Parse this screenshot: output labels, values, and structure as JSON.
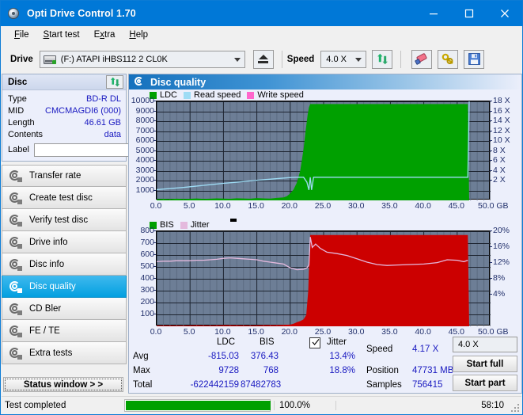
{
  "window": {
    "title": "Opti Drive Control 1.70",
    "icon": "disc-icon",
    "minimize": "minimize-icon",
    "maximize": "maximize-icon",
    "close": "close-icon"
  },
  "menubar": {
    "items": [
      {
        "label": "File",
        "accel": "F"
      },
      {
        "label": "Start test",
        "accel": "S"
      },
      {
        "label": "Extra",
        "accel": "x"
      },
      {
        "label": "Help",
        "accel": "H"
      }
    ]
  },
  "toolbar": {
    "drive_label": "Drive",
    "drive_value": "(F:)   ATAPI iHBS112   2 CL0K",
    "eject_icon": "eject-icon",
    "speed_label": "Speed",
    "speed_value": "4.0 X",
    "refresh_icon": "refresh-icon",
    "erase_icon": "eraser-icon",
    "tools_icon": "tools-icon",
    "save_icon": "save-icon"
  },
  "disc_panel": {
    "title": "Disc",
    "refresh_icon": "refresh-icon",
    "rows": [
      {
        "key": "Type",
        "value": "BD-R DL"
      },
      {
        "key": "MID",
        "value": "CMCMAGDI6 (000)"
      },
      {
        "key": "Length",
        "value": "46.61 GB"
      },
      {
        "key": "Contents",
        "value": "data"
      }
    ],
    "label_key": "Label",
    "label_value": "",
    "label_placeholder": "",
    "label_disc_icon": "cd-disc-icon"
  },
  "nav": {
    "items": [
      {
        "label": "Transfer rate",
        "selected": false
      },
      {
        "label": "Create test disc",
        "selected": false
      },
      {
        "label": "Verify test disc",
        "selected": false
      },
      {
        "label": "Drive info",
        "selected": false
      },
      {
        "label": "Disc info",
        "selected": false
      },
      {
        "label": "Disc quality",
        "selected": true
      },
      {
        "label": "CD Bler",
        "selected": false
      },
      {
        "label": "FE / TE",
        "selected": false
      },
      {
        "label": "Extra tests",
        "selected": false
      }
    ],
    "status_window_label": "Status window > >"
  },
  "main": {
    "header_title": "Disc quality",
    "header_icon": "disc-quality-icon"
  },
  "chart_data": [
    {
      "type": "area",
      "name": "ldc-chart",
      "title": "",
      "xlabel": "GB",
      "ylabel": "LDC",
      "legend": [
        {
          "label": "LDC",
          "color": "#00a000"
        },
        {
          "label": "Read speed",
          "color": "#9edcf5"
        },
        {
          "label": "Write speed",
          "color": "#ff66cc"
        }
      ],
      "legend_position": "top-left",
      "grid": true,
      "plot_bg": "#6d7e96",
      "xlim": [
        0,
        50
      ],
      "xticks": [
        "0.0",
        "5.0",
        "10.0",
        "15.0",
        "20.0",
        "25.0",
        "30.0",
        "35.0",
        "40.0",
        "45.0",
        "50.0"
      ],
      "xunit": "GB",
      "ylim": [
        0,
        10000
      ],
      "yticks": [
        "10000",
        "9000",
        "8000",
        "7000",
        "6000",
        "5000",
        "4000",
        "3000",
        "2000",
        "1000"
      ],
      "y2lim": [
        0,
        18
      ],
      "y2ticks": [
        "18 X",
        "16 X",
        "14 X",
        "12 X",
        "10 X",
        "8 X",
        "6 X",
        "4 X",
        "2 X"
      ],
      "series": [
        {
          "name": "LDC",
          "color": "#00a000",
          "kind": "area",
          "x": [
            0.0,
            1.0,
            2.0,
            3.0,
            4.0,
            5.0,
            6.0,
            7.0,
            8.0,
            9.0,
            10.0,
            11.0,
            12.0,
            13.0,
            14.0,
            15.0,
            16.0,
            17.0,
            18.0,
            19.0,
            19.5,
            20.0,
            20.5,
            21.0,
            21.5,
            22.0,
            22.3,
            22.6,
            22.8,
            23.0,
            24.0,
            28.0,
            32.0,
            36.0,
            40.0,
            44.0,
            46.6,
            46.8
          ],
          "values": [
            120,
            150,
            130,
            170,
            140,
            160,
            190,
            150,
            170,
            200,
            180,
            160,
            210,
            190,
            170,
            230,
            200,
            180,
            250,
            300,
            420,
            700,
            1100,
            1800,
            3000,
            5200,
            7000,
            8600,
            9400,
            9728,
            9728,
            9728,
            9728,
            9728,
            9728,
            9728,
            9728,
            0
          ]
        },
        {
          "name": "Read speed",
          "color": "#9edcf5",
          "kind": "line",
          "x": [
            0.0,
            2.0,
            4.0,
            6.0,
            8.0,
            10.0,
            12.0,
            14.0,
            16.0,
            18.0,
            20.0,
            21.0,
            22.0,
            22.5,
            22.8,
            23.0,
            23.2,
            23.5,
            24.0,
            30.0,
            36.0,
            42.0,
            46.6,
            46.8
          ],
          "values": [
            1.95,
            2.15,
            2.35,
            2.6,
            2.85,
            3.1,
            3.3,
            3.55,
            3.75,
            3.95,
            4.15,
            4.2,
            4.2,
            3.3,
            1.9,
            4.2,
            1.9,
            4.2,
            4.2,
            4.2,
            4.2,
            4.2,
            4.2,
            18.0
          ]
        }
      ]
    },
    {
      "type": "area",
      "name": "bis-jitter-chart",
      "title": "",
      "xlabel": "GB",
      "ylabel": "BIS",
      "legend": [
        {
          "label": "BIS",
          "color": "#00a000"
        },
        {
          "label": "Jitter",
          "color": "#e4b9dd"
        }
      ],
      "legend_position": "top-left",
      "grid": true,
      "plot_bg": "#6d7e96",
      "xlim": [
        0,
        50
      ],
      "xticks": [
        "0.0",
        "5.0",
        "10.0",
        "15.0",
        "20.0",
        "25.0",
        "30.0",
        "35.0",
        "40.0",
        "45.0",
        "50.0"
      ],
      "xunit": "GB",
      "ylim": [
        0,
        800
      ],
      "yticks": [
        "800",
        "700",
        "600",
        "500",
        "400",
        "300",
        "200",
        "100"
      ],
      "y2lim": [
        0,
        20
      ],
      "y2ticks": [
        "20%",
        "16%",
        "12%",
        "8%",
        "4%"
      ],
      "series": [
        {
          "name": "BIS",
          "color": "#cc0000",
          "kind": "area",
          "x": [
            0.0,
            2.0,
            4.0,
            6.0,
            8.0,
            10.0,
            12.0,
            14.0,
            16.0,
            18.0,
            20.0,
            20.5,
            21.0,
            21.5,
            22.0,
            22.4,
            22.7,
            22.9,
            23.0,
            24.0,
            28.0,
            32.0,
            36.0,
            40.0,
            44.0,
            46.6,
            46.8
          ],
          "values": [
            6,
            7,
            6,
            8,
            7,
            9,
            8,
            7,
            9,
            10,
            14,
            22,
            34,
            44,
            58,
            95,
            300,
            640,
            768,
            768,
            768,
            768,
            768,
            768,
            768,
            768,
            0
          ]
        },
        {
          "name": "Jitter",
          "color": "#e4b9dd",
          "kind": "line",
          "x": [
            0.0,
            1.0,
            2.0,
            3.0,
            4.0,
            5.0,
            6.0,
            7.0,
            8.0,
            9.0,
            10.0,
            11.0,
            12.0,
            13.0,
            14.0,
            15.0,
            16.0,
            17.0,
            18.0,
            19.0,
            20.0,
            21.0,
            22.0,
            22.5,
            22.8,
            23.0,
            23.3,
            23.8,
            24.5,
            25.5,
            27.0,
            28.5,
            30.0,
            31.5,
            33.0,
            34.5,
            36.0,
            38.0,
            40.0,
            42.0,
            43.5,
            45.0,
            46.0,
            46.6
          ],
          "values": [
            13.6,
            13.7,
            13.7,
            13.8,
            13.8,
            13.8,
            13.9,
            13.9,
            14.0,
            14.1,
            14.3,
            14.4,
            14.3,
            14.2,
            14.1,
            14.0,
            13.7,
            13.5,
            13.3,
            13.1,
            12.3,
            11.9,
            12.0,
            12.3,
            12.9,
            18.8,
            16.6,
            17.3,
            16.4,
            15.6,
            15.3,
            14.9,
            14.2,
            13.5,
            13.0,
            12.8,
            12.9,
            13.0,
            13.1,
            13.4,
            14.0,
            13.9,
            13.6,
            13.9
          ]
        }
      ]
    }
  ],
  "stats": {
    "col_headers": [
      "LDC",
      "BIS"
    ],
    "row_labels": [
      "Avg",
      "Max",
      "Total"
    ],
    "ldc": {
      "avg": "-815.03",
      "max": "9728",
      "total": "-622442159"
    },
    "bis": {
      "avg": "376.43",
      "max": "768",
      "total": "87482783"
    },
    "jitter": {
      "checkbox_label": "Jitter",
      "checked": true,
      "avg": "13.4%",
      "max": "18.8%"
    },
    "speed_label": "Speed",
    "speed_value": "4.17 X",
    "position_label": "Position",
    "position_value": "47731 MB",
    "samples_label": "Samples",
    "samples_value": "756415",
    "speed_select_value": "4.0 X",
    "start_full_label": "Start full",
    "start_part_label": "Start part"
  },
  "statusbar": {
    "text": "Test completed",
    "progress_percent": "100.0%",
    "progress_value": 100,
    "elapsed": "58:10"
  },
  "colors": {
    "accent": "#0078d7",
    "ldc_green": "#00a000",
    "bis_red": "#cc0000",
    "jitter_pink": "#e4b9dd",
    "read_speed": "#9edcf5",
    "write_speed": "#ff66cc",
    "plot_bg": "#6d7e96",
    "value_blue": "#1818c0"
  }
}
